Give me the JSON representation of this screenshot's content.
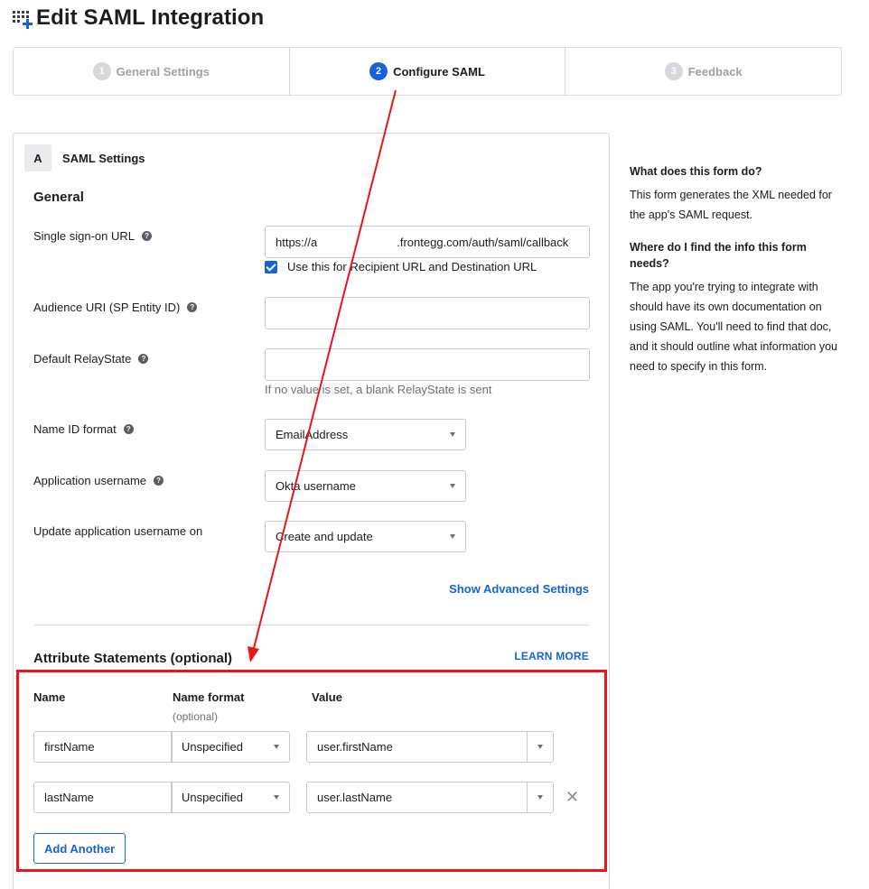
{
  "page": {
    "title": "Edit SAML Integration",
    "app_icon": "app-grid-plus-icon"
  },
  "steps": [
    {
      "number": "1",
      "label": "General Settings",
      "state": "done"
    },
    {
      "number": "2",
      "label": "Configure SAML",
      "state": "active"
    },
    {
      "number": "3",
      "label": "Feedback",
      "state": "pending"
    }
  ],
  "section": {
    "letter": "A",
    "title": "SAML Settings"
  },
  "general": {
    "heading": "General",
    "sso_url": {
      "label": "Single sign-on URL",
      "value_prefix": "https://a",
      "value_suffix": ".frontegg.com/auth/saml/callback"
    },
    "recipient_checkbox": {
      "label": "Use this for Recipient URL and Destination URL",
      "checked": true
    },
    "audience_uri": {
      "label": "Audience URI (SP Entity ID)",
      "value": ""
    },
    "relay_state": {
      "label": "Default RelayState",
      "value": "",
      "hint": "If no value is set, a blank RelayState is sent"
    },
    "name_id_format": {
      "label": "Name ID format",
      "value": "EmailAddress"
    },
    "app_username": {
      "label": "Application username",
      "value": "Okta username"
    },
    "update_username_on": {
      "label": "Update application username on",
      "value": "Create and update"
    },
    "advanced_link": "Show Advanced Settings"
  },
  "attributes": {
    "heading": "Attribute Statements (optional)",
    "learn_more": "LEARN MORE",
    "columns": {
      "name": "Name",
      "format": "Name format",
      "format_sub": "(optional)",
      "value": "Value"
    },
    "rows": [
      {
        "name": "firstName",
        "format": "Unspecified",
        "value": "user.firstName"
      },
      {
        "name": "lastName",
        "format": "Unspecified",
        "value": "user.lastName"
      }
    ],
    "add_button": "Add Another"
  },
  "help": {
    "q1": "What does this form do?",
    "a1": "This form generates the XML needed for the app's SAML request.",
    "q2": "Where do I find the info this form needs?",
    "a2": "The app you're trying to integrate with should have its own documentation on using SAML. You'll need to find that doc, and it should outline what information you need to specify in this form."
  },
  "colors": {
    "accent": "#1662dd",
    "annotation": "#e8151b",
    "border": "#d7d7dc"
  }
}
